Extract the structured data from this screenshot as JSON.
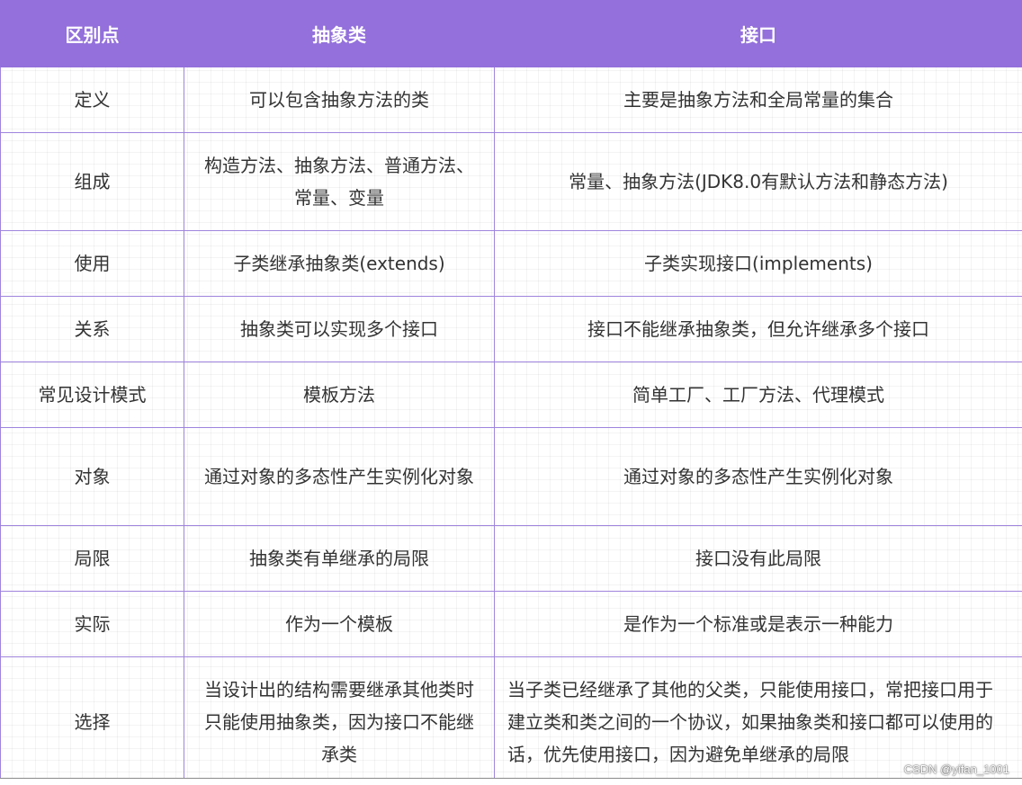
{
  "table": {
    "headers": [
      "区别点",
      "抽象类",
      "接口"
    ],
    "rows": [
      [
        "定义",
        "可以包含抽象方法的类",
        "主要是抽象方法和全局常量的集合"
      ],
      [
        "组成",
        "构造方法、抽象方法、普通方法、常量、变量",
        "常量、抽象方法(JDK8.0有默认方法和静态方法)"
      ],
      [
        "使用",
        "子类继承抽象类(extends)",
        "子类实现接口(implements)"
      ],
      [
        "关系",
        "抽象类可以实现多个接口",
        "接口不能继承抽象类，但允许继承多个接口"
      ],
      [
        "常见设计模式",
        "模板方法",
        "简单工厂、工厂方法、代理模式"
      ],
      [
        "对象",
        "通过对象的多态性产生实例化对象",
        "通过对象的多态性产生实例化对象"
      ],
      [
        "局限",
        "抽象类有单继承的局限",
        "接口没有此局限"
      ],
      [
        "实际",
        "作为一个模板",
        "是作为一个标准或是表示一种能力"
      ],
      [
        "选择",
        "当设计出的结构需要继承其他类时只能使用抽象类，因为接口不能继承类",
        "当子类已经继承了其他的父类，只能使用接口，常把接口用于建立类和类之间的一个协议，如果抽象类和接口都可以使用的话，优先使用接口，因为避免单继承的局限"
      ]
    ]
  },
  "watermark": "CSDN @yifan_1001",
  "colors": {
    "header_bg": "#9370db",
    "header_text": "#ffffff",
    "border": "#9f84dd",
    "cell_text": "#333333"
  }
}
